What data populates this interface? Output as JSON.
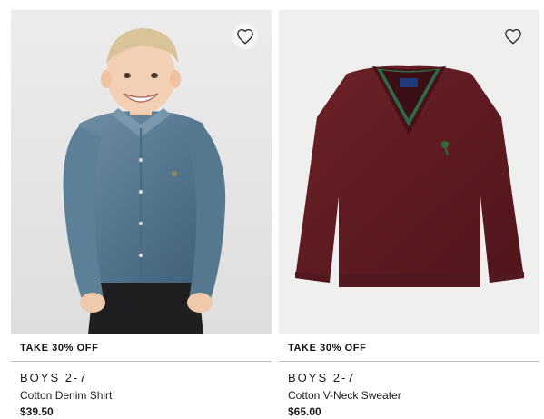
{
  "products": [
    {
      "promo": "TAKE 30% OFF",
      "category": "BOYS 2-7",
      "name": "Cotton Denim Shirt",
      "price": "$39.50",
      "image": "boy-denim-shirt-photo",
      "favorite_icon": "heart-outline-icon"
    },
    {
      "promo": "TAKE 30% OFF",
      "category": "BOYS 2-7",
      "name": "Cotton V-Neck Sweater",
      "price": "$65.00",
      "image": "burgundy-vneck-sweater-photo",
      "favorite_icon": "heart-outline-icon"
    }
  ],
  "colors": {
    "denim": "#5a7d95",
    "burgundy": "#5e1a20",
    "logo_green": "#2e6b3a"
  }
}
